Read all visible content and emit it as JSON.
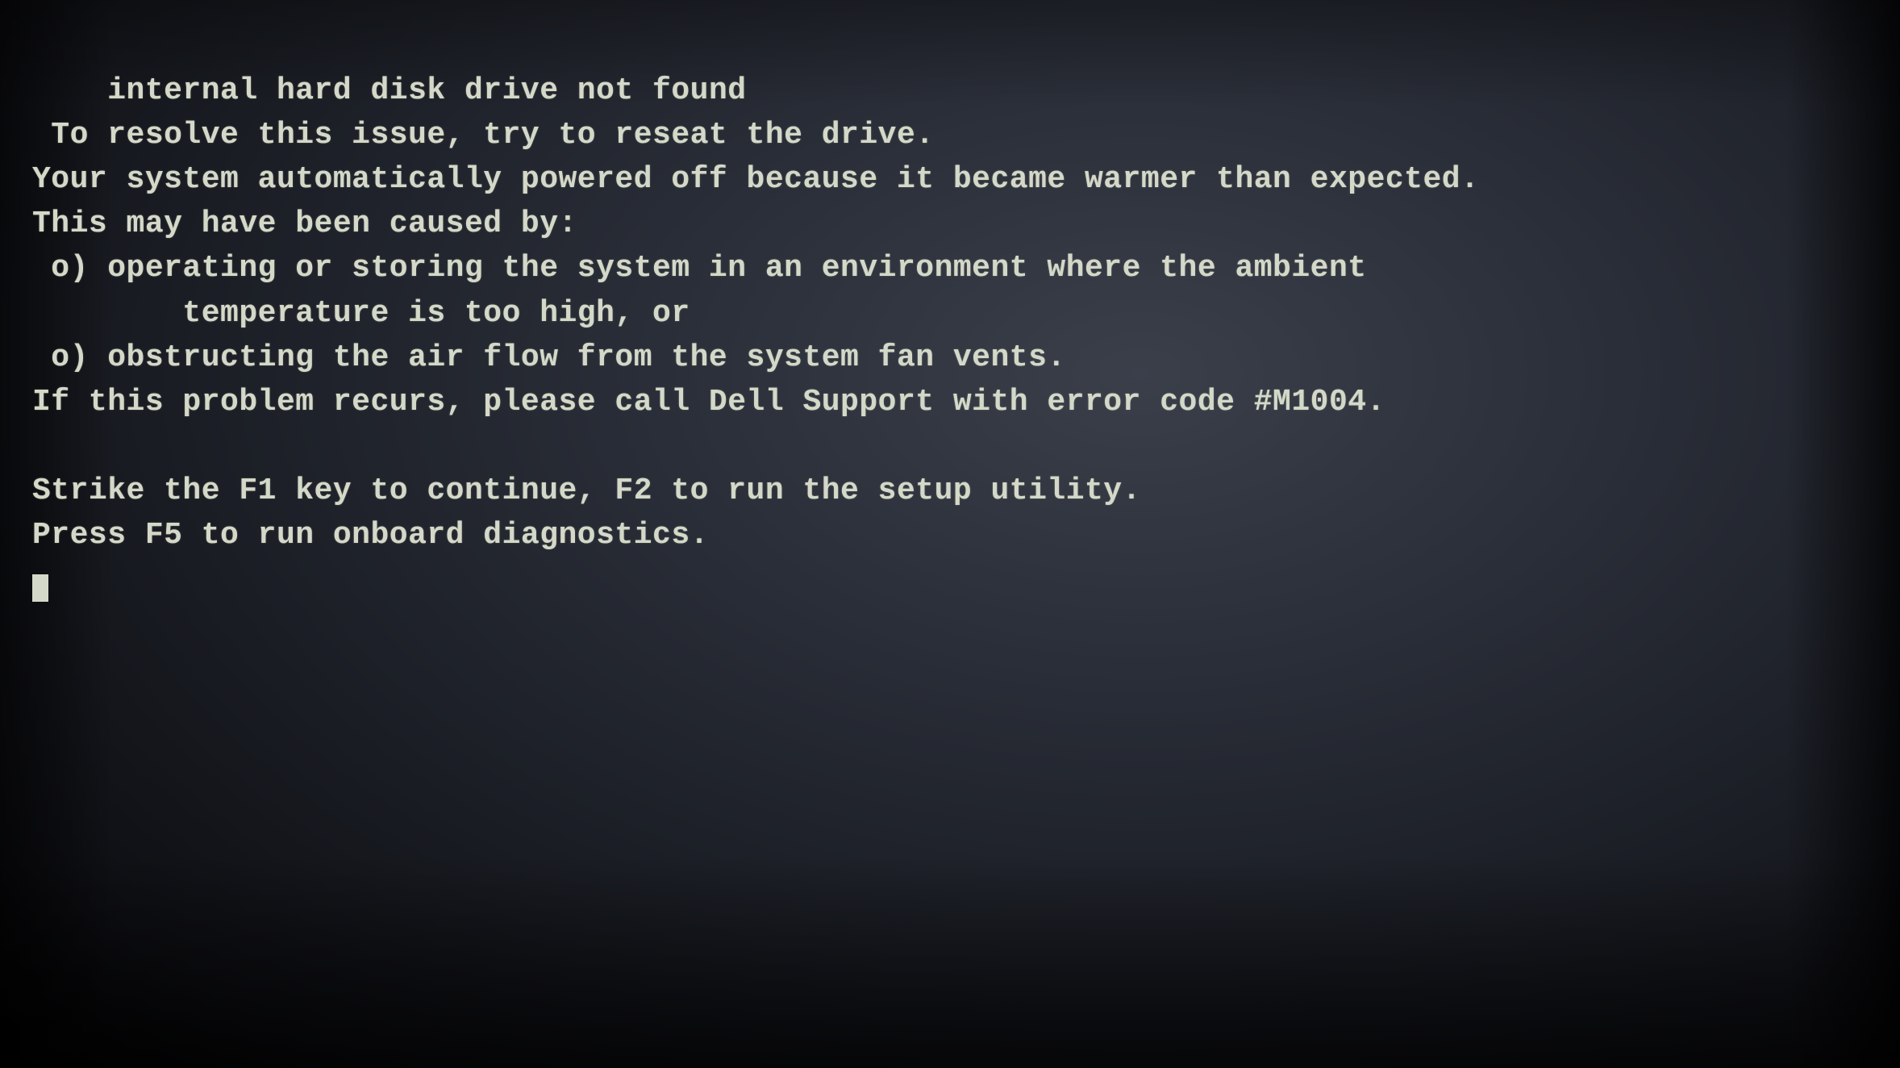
{
  "screen": {
    "background_color": "#1e2229",
    "text_color": "#d4d8c8"
  },
  "terminal": {
    "lines": [
      "internal hard disk drive not found",
      " To resolve this issue, try to reseat the drive.",
      "Your system automatically powered off because it became warmer than expected.",
      "This may have been caused by:",
      " o) operating or storing the system in an environment where the ambient",
      "        temperature is too high, or",
      " o) obstructing the air flow from the system fan vents.",
      "If this problem recurs, please call Dell Support with error code #M1004.",
      "",
      "Strike the F1 key to continue, F2 to run the setup utility.",
      "Press F5 to run onboard diagnostics.",
      ""
    ],
    "cursor_char": "_"
  }
}
